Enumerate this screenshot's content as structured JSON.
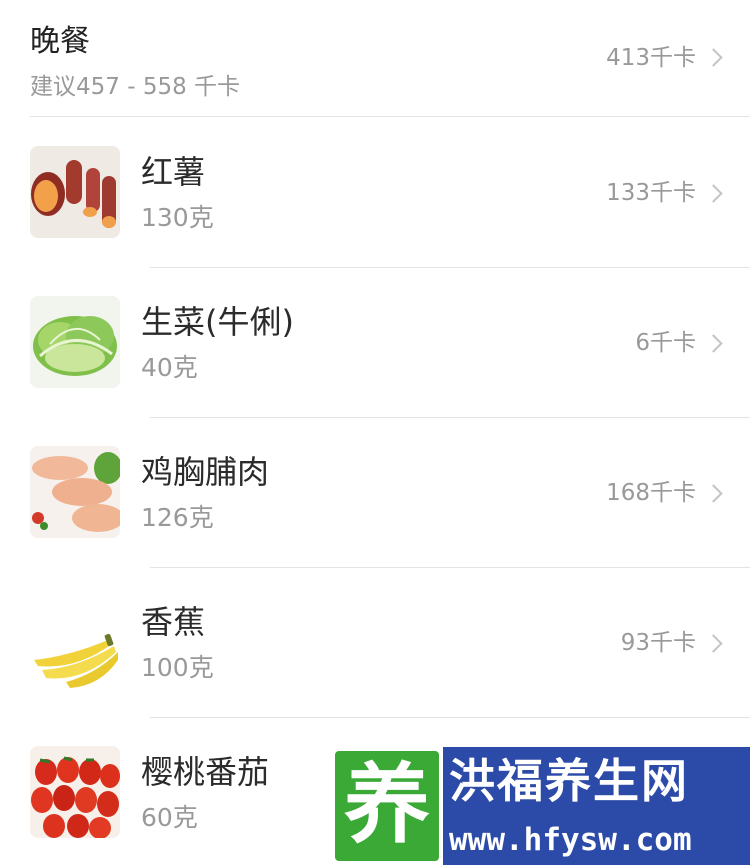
{
  "meal": {
    "title": "晚餐",
    "suggestion": "建议457 - 558 千卡",
    "total_kcal": "413千卡"
  },
  "foods": [
    {
      "name": "红薯",
      "amount": "130克",
      "kcal": "133千卡",
      "icon": "sweet-potato-photo"
    },
    {
      "name": "生菜(牛俐)",
      "amount": "40克",
      "kcal": "6千卡",
      "icon": "lettuce-photo"
    },
    {
      "name": "鸡胸脯肉",
      "amount": "126克",
      "kcal": "168千卡",
      "icon": "chicken-breast-photo"
    },
    {
      "name": "香蕉",
      "amount": "100克",
      "kcal": "93千卡",
      "icon": "banana-photo"
    },
    {
      "name": "樱桃番茄",
      "amount": "60克",
      "kcal": "",
      "icon": "cherry-tomato-photo"
    }
  ],
  "watermark": {
    "logo_char": "养",
    "site_name": "洪福养生网",
    "url": "www.hfysw.com"
  },
  "colors": {
    "text_primary": "#2b2b2b",
    "text_secondary": "#999999",
    "divider": "#e3e3e3",
    "watermark_bg": "#2c4aa8",
    "watermark_logo": "#3aa935"
  }
}
